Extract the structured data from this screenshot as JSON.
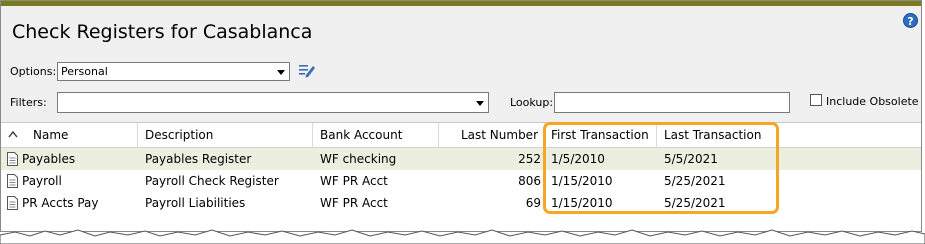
{
  "window": {
    "title": "Check Registers for Casablanca",
    "help_glyph": "?"
  },
  "options": {
    "label": "Options:",
    "value": "Personal"
  },
  "filters": {
    "label": "Filters:",
    "value": ""
  },
  "lookup": {
    "label": "Lookup:",
    "value": ""
  },
  "include_obsolete": {
    "label": "Include Obsolete",
    "checked": false
  },
  "table": {
    "sort_glyph": "^",
    "columns": [
      "Name",
      "Description",
      "Bank Account",
      "Last Number",
      "First Transaction",
      "Last Transaction"
    ],
    "rows": [
      {
        "name": "Payables",
        "description": "Payables Register",
        "bank_account": "WF checking",
        "last_number": "252",
        "first_transaction": "1/5/2010",
        "last_transaction": "5/5/2021",
        "selected": true
      },
      {
        "name": "Payroll",
        "description": "Payroll Check Register",
        "bank_account": "WF PR Acct",
        "last_number": "806",
        "first_transaction": "1/15/2010",
        "last_transaction": "5/25/2021",
        "selected": false
      },
      {
        "name": "PR Accts Pay",
        "description": "Payroll Liabilities",
        "bank_account": "WF PR Acct",
        "last_number": "69",
        "first_transaction": "1/15/2010",
        "last_transaction": "5/25/2021",
        "selected": false
      }
    ]
  },
  "icons": {
    "row_icon": "document-icon",
    "edit": "edit-options-icon",
    "help": "help-icon"
  },
  "colors": {
    "highlight": "#f5a623",
    "header_bar": "#7a7a1e",
    "selected_row": "#ecefe0",
    "help": "#2b6fc2"
  }
}
